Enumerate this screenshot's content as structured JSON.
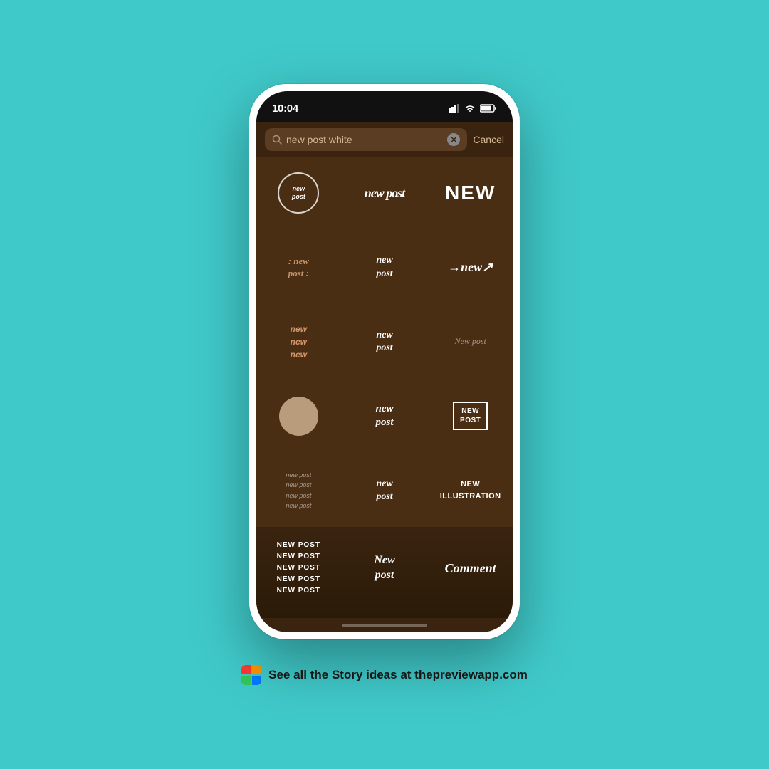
{
  "background": "#40C9C9",
  "statusBar": {
    "time": "10:04",
    "signal": "▋▋▋",
    "wifi": "WiFi",
    "battery": "🔋"
  },
  "search": {
    "placeholder": "new post white",
    "cancelLabel": "Cancel"
  },
  "stickers": [
    {
      "id": "circle-new-post",
      "type": "circle-new-post",
      "text": "new\npost"
    },
    {
      "id": "script-new-post",
      "type": "script-new-post",
      "text": "new post"
    },
    {
      "id": "bold-new",
      "type": "bold-new",
      "text": "NEW"
    },
    {
      "id": "dots-new-post",
      "type": "dots-new-post",
      "text": ": new\npost :"
    },
    {
      "id": "white-new-post",
      "type": "white-new-post",
      "text": "new\npost"
    },
    {
      "id": "arrow-new",
      "type": "arrow-new",
      "text": "→new↗"
    },
    {
      "id": "triple-new",
      "type": "triple-new",
      "text": "new\nnew\nnew"
    },
    {
      "id": "script2-new-post",
      "type": "script2-new-post",
      "text": "new\npost"
    },
    {
      "id": "light-new-post",
      "type": "light-new-post",
      "text": "New post"
    },
    {
      "id": "circle-cream",
      "type": "circle-cream",
      "text": ""
    },
    {
      "id": "modern-new-post",
      "type": "modern-new-post",
      "text": "new\npost"
    },
    {
      "id": "box-new-post",
      "type": "box-new-post",
      "text": "NEW\nPOST"
    },
    {
      "id": "multi-line",
      "type": "multi-line",
      "text": "new post\nnew post\nnew post\nnew post"
    },
    {
      "id": "cursive-new-post",
      "type": "cursive-new-post",
      "text": "new\npost"
    },
    {
      "id": "bold-new-illustration",
      "type": "bold-new-illustration",
      "text": "NEW\nillustration"
    }
  ],
  "bottomRow": [
    {
      "id": "stacked-new-post",
      "type": "stacked-new-post",
      "text": "NEW POST\nNEW POST\nNEW POST\nNEW POST\nNEW POST"
    },
    {
      "id": "cursive-new-post2",
      "type": "cursive-new-post2",
      "text": "New\npost"
    },
    {
      "id": "cursive-comment",
      "type": "cursive-comment",
      "text": "Comment"
    }
  ],
  "footer": {
    "text": "See all the Story ideas at thepreviewapp.com"
  }
}
